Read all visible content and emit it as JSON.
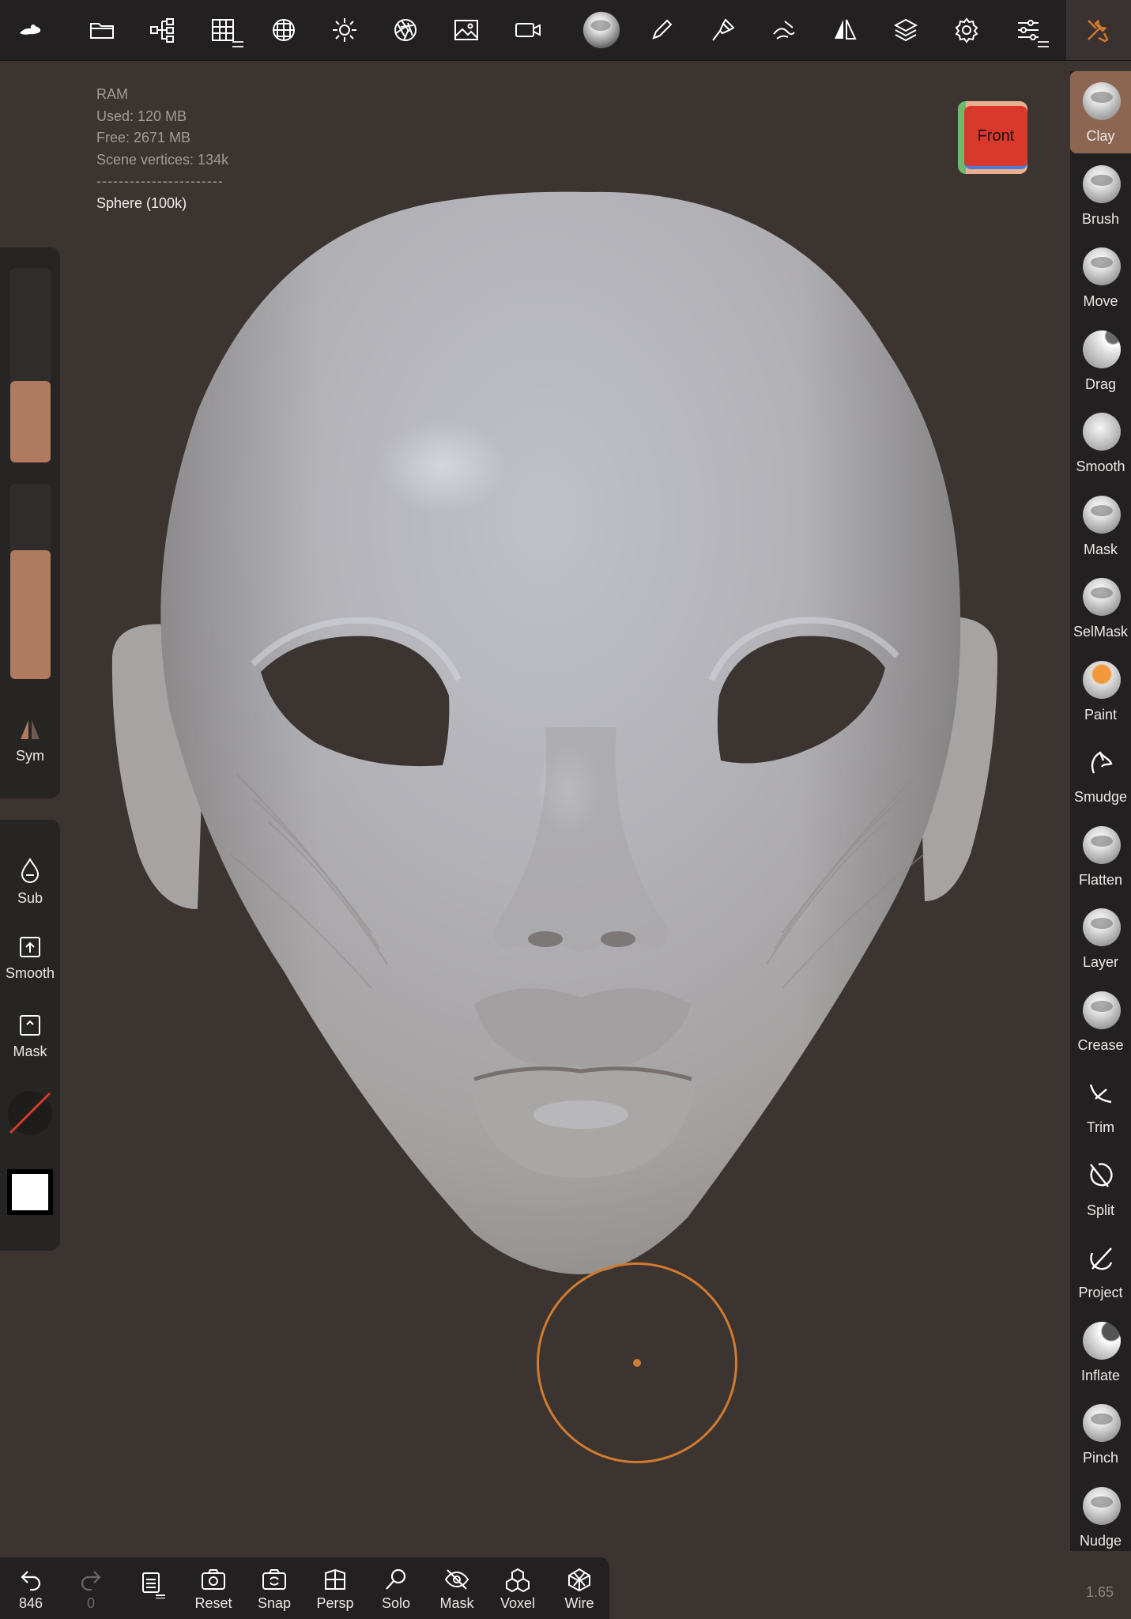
{
  "toolbar": {
    "icons": [
      "home-icon",
      "folder-icon",
      "scene-tree-icon",
      "grid-icon",
      "mesh-icon",
      "light-icon",
      "camera-aperture-icon",
      "image-icon",
      "video-icon",
      "matcap-sphere-icon",
      "pen-icon",
      "brush-picker-icon",
      "stroke-icon",
      "symmetry-icon",
      "layers-icon",
      "settings-icon",
      "sliders-icon",
      "tools-icon"
    ]
  },
  "scene_info": {
    "ram_label": "RAM",
    "used": "Used: 120 MB",
    "free": "Free: 2671 MB",
    "vertices": "Scene vertices: 134k",
    "separator": "-----------------------",
    "selected": "Sphere (100k)"
  },
  "view_cube": {
    "face": "Front"
  },
  "left_panel": {
    "size_fraction": 0.42,
    "intensity_fraction": 0.66,
    "sym_label": "Sym",
    "sub_label": "Sub",
    "smooth_label": "Smooth",
    "mask_label": "Mask"
  },
  "brushes": [
    {
      "label": "Clay",
      "active": true
    },
    {
      "label": "Brush"
    },
    {
      "label": "Move"
    },
    {
      "label": "Drag"
    },
    {
      "label": "Smooth"
    },
    {
      "label": "Mask"
    },
    {
      "label": "SelMask"
    },
    {
      "label": "Paint"
    },
    {
      "label": "Smudge"
    },
    {
      "label": "Flatten"
    },
    {
      "label": "Layer"
    },
    {
      "label": "Crease"
    },
    {
      "label": "Trim"
    },
    {
      "label": "Split"
    },
    {
      "label": "Project"
    },
    {
      "label": "Inflate"
    },
    {
      "label": "Pinch"
    },
    {
      "label": "Nudge"
    }
  ],
  "bottom_bar": {
    "undo_count": "846",
    "redo_count": "0",
    "reset": "Reset",
    "snap": "Snap",
    "persp": "Persp",
    "solo": "Solo",
    "mask": "Mask",
    "voxel": "Voxel",
    "wire": "Wire"
  },
  "zoom": "1.65",
  "colors": {
    "accent": "#d27a2e",
    "active_brush": "#8c6653",
    "slider": "#b07a5e",
    "background": "#3b3431"
  }
}
